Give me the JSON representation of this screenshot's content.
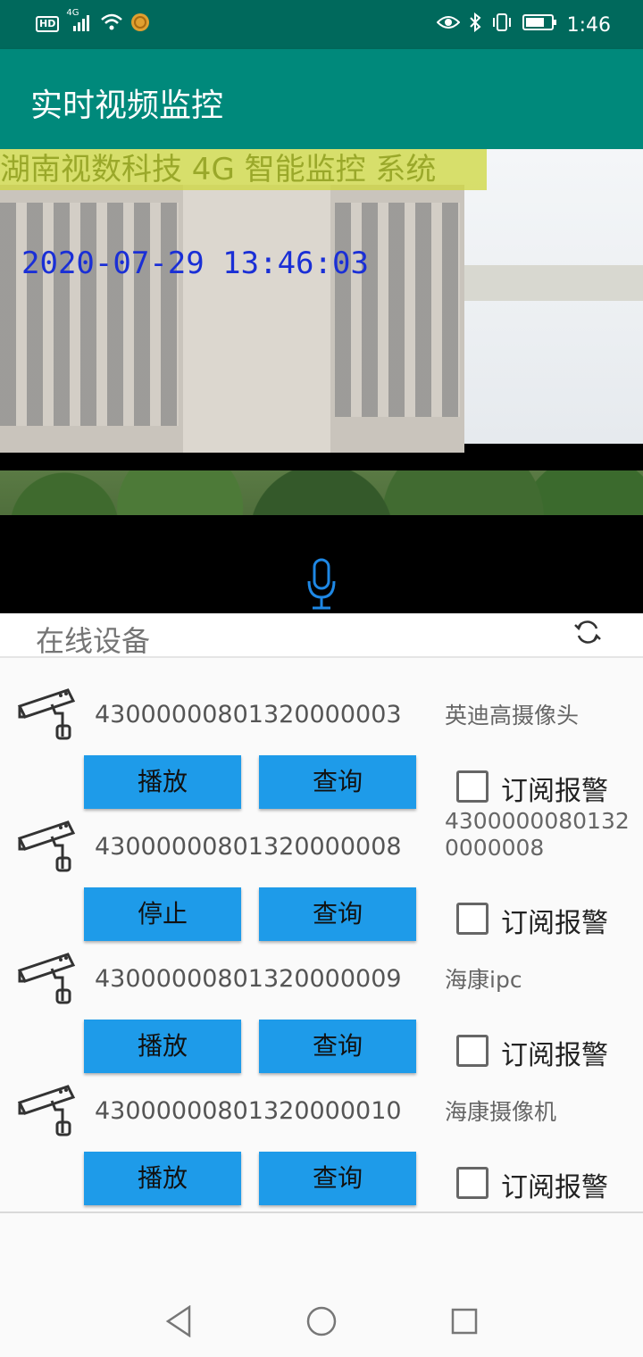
{
  "status_bar": {
    "left_icons": [
      "hd-icon",
      "signal-4g-icon",
      "wifi-icon",
      "coin-icon"
    ],
    "right_icons": [
      "eye-icon",
      "bluetooth-icon",
      "vibrate-icon",
      "battery-icon"
    ],
    "hd_label": "HD",
    "network_label": "4G",
    "time": "1:46"
  },
  "app_bar": {
    "title": "实时视频监控"
  },
  "video": {
    "osd_banner": "湖南视数科技 4G 智能监控 系统",
    "osd_timestamp": "2020-07-29 13:46:03"
  },
  "devices_section": {
    "title": "在线设备"
  },
  "devices": [
    {
      "id": "43000000801320000003",
      "name": "英迪高摄像头",
      "primary_action": "播放",
      "query_action": "查询",
      "subscribe_label": "订阅报警"
    },
    {
      "id": "43000000801320000008",
      "name": "43000000801320000008",
      "primary_action": "停止",
      "query_action": "查询",
      "subscribe_label": "订阅报警"
    },
    {
      "id": "43000000801320000009",
      "name": "海康ipc",
      "primary_action": "播放",
      "query_action": "查询",
      "subscribe_label": "订阅报警"
    },
    {
      "id": "43000000801320000010",
      "name": "海康摄像机",
      "primary_action": "播放",
      "query_action": "查询",
      "subscribe_label": "订阅报警"
    }
  ],
  "colors": {
    "status_bar": "#00695c",
    "app_bar": "#00897b",
    "button": "#1e9be9",
    "mic": "#1e88e5"
  },
  "navigation_bar": {
    "icons": [
      "back-icon",
      "home-icon",
      "recents-icon"
    ]
  }
}
